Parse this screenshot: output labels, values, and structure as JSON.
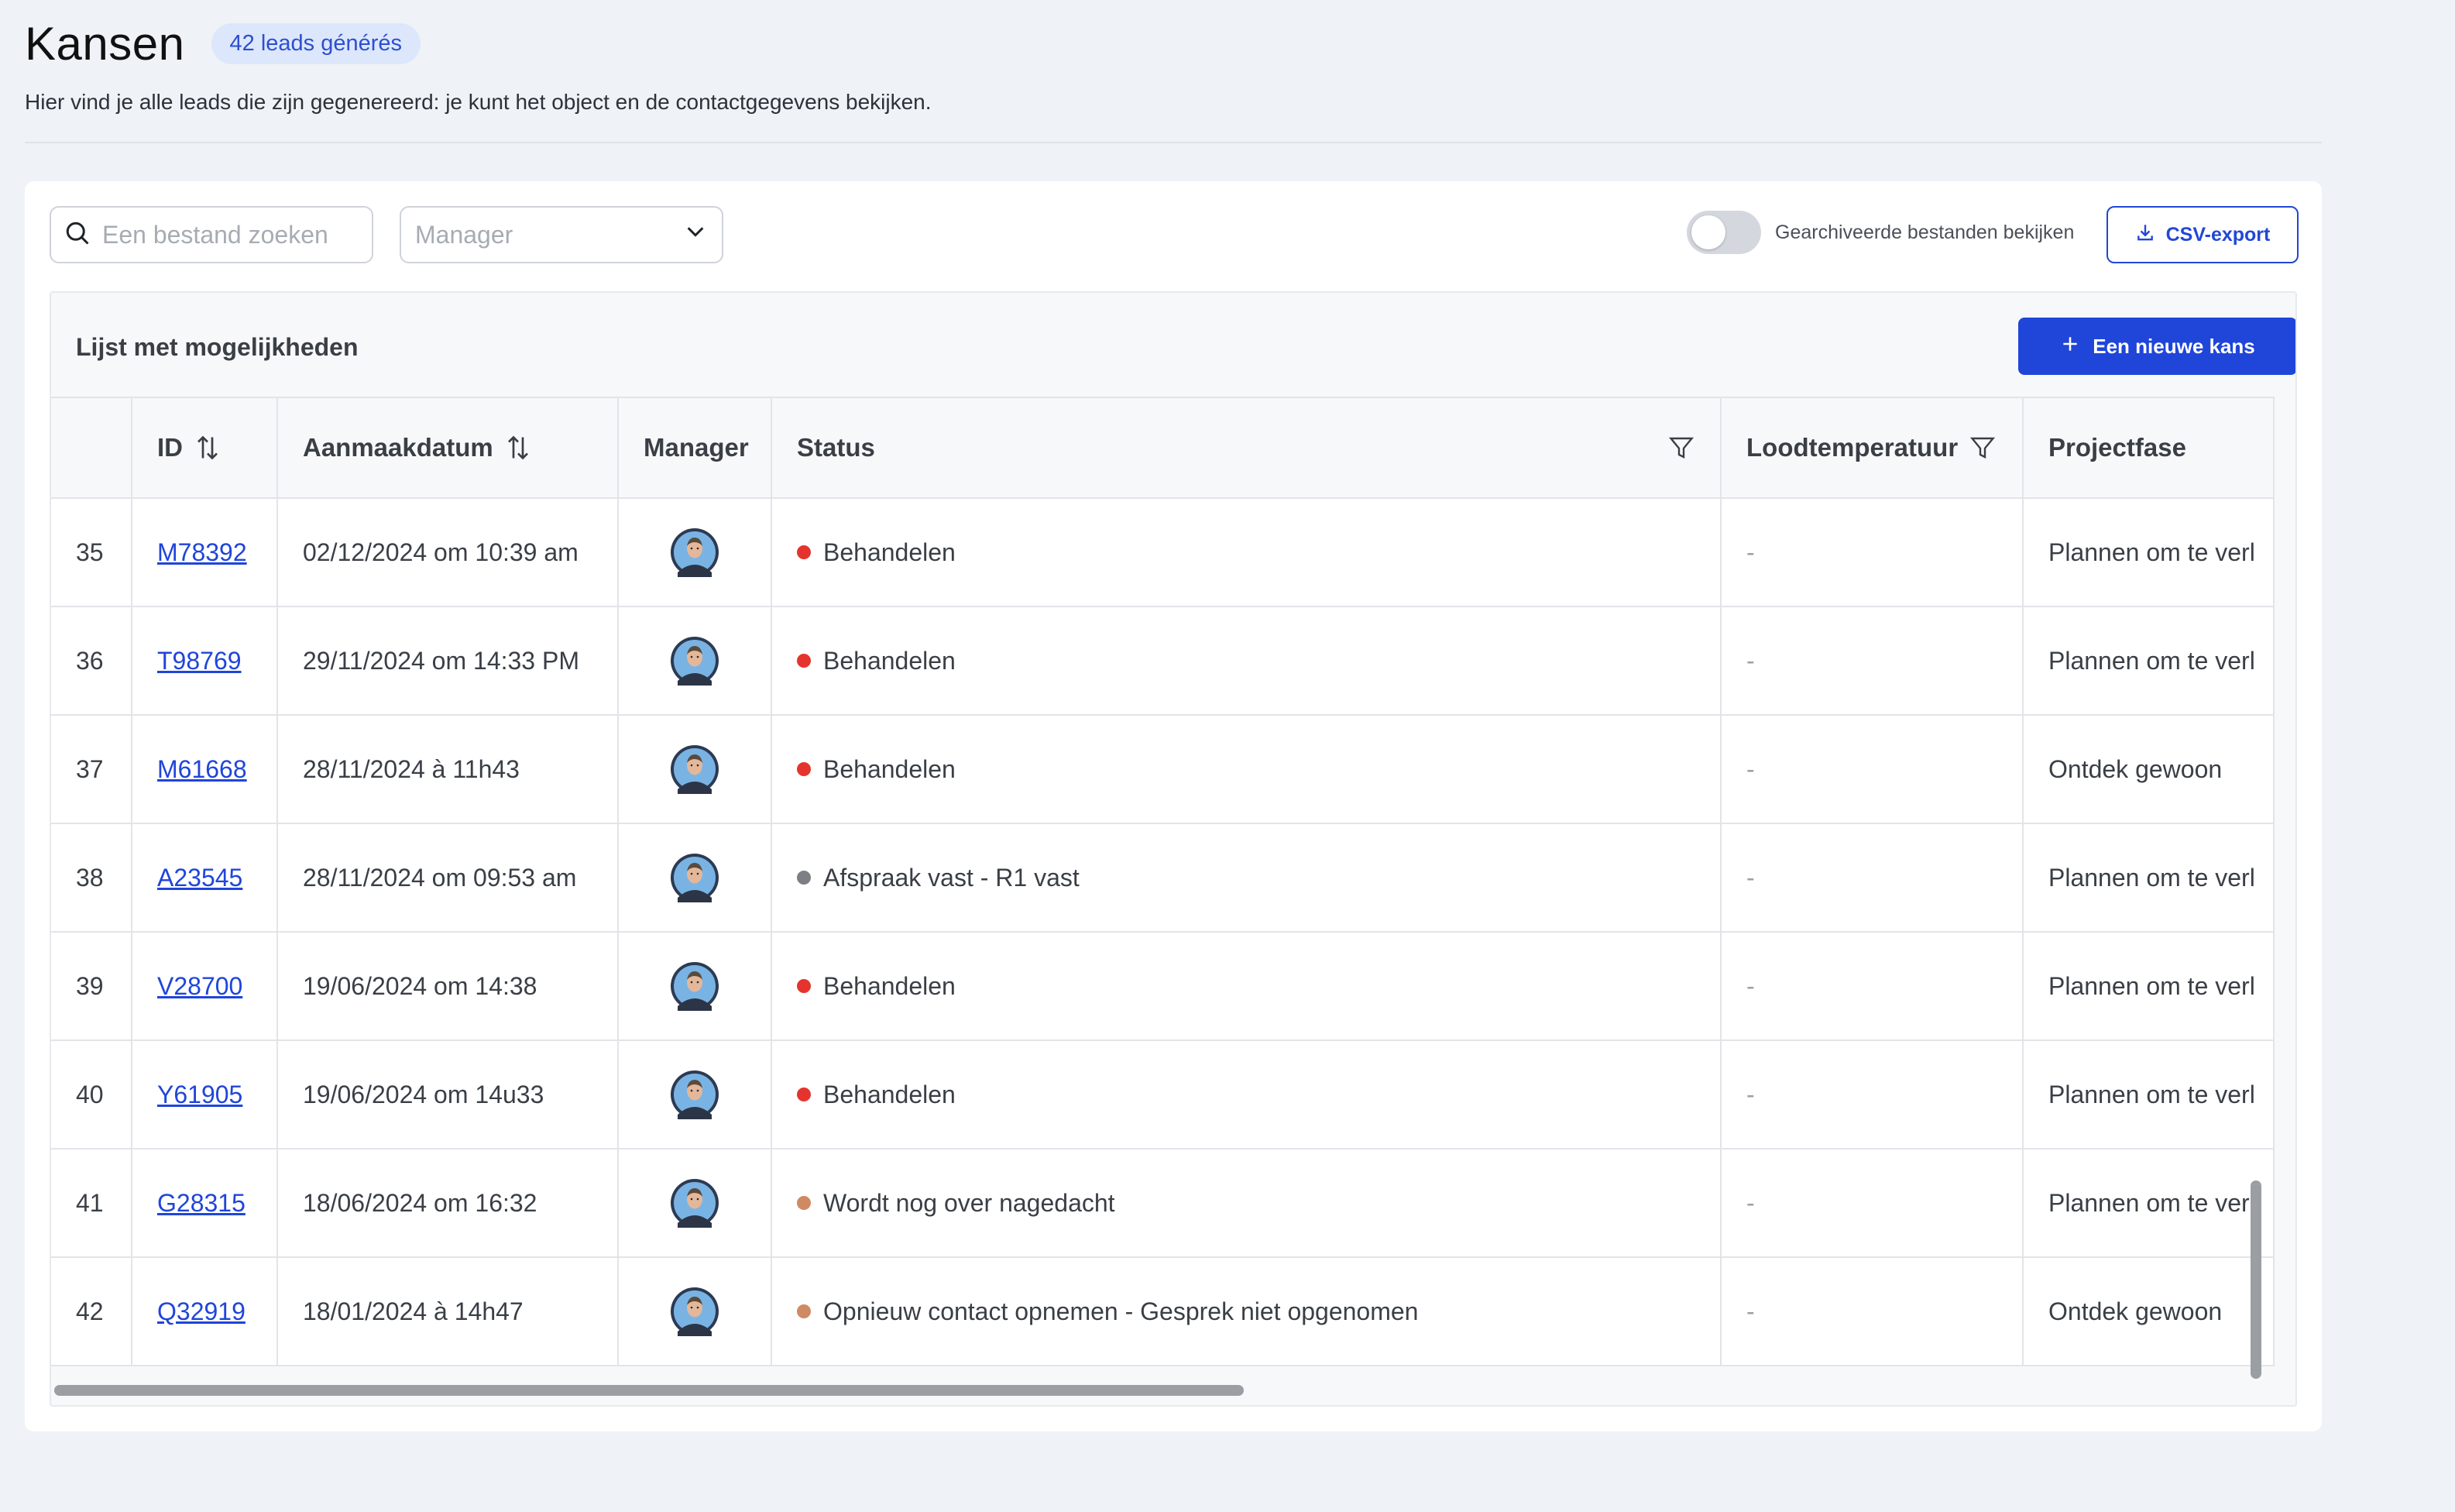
{
  "header": {
    "title": "Kansen",
    "badge": "42 leads générés",
    "subtitle": "Hier vind je alle leads die zijn gegenereerd: je kunt het object en de contactgegevens bekijken."
  },
  "toolbar": {
    "search_placeholder": "Een bestand zoeken",
    "manager_placeholder": "Manager",
    "archived_toggle_label": "Gearchiveerde bestanden bekijken",
    "archived_toggle_on": false,
    "csv_export_label": "CSV-export"
  },
  "panel": {
    "title": "Lijst met mogelijkheden",
    "new_button_label": "Een nieuwe kans"
  },
  "table": {
    "columns": {
      "index": "",
      "id": "ID",
      "created": "Aanmaakdatum",
      "manager": "Manager",
      "status": "Status",
      "temperature": "Loodtemperatuur",
      "phase": "Projectfase"
    },
    "rows": [
      {
        "num": "35",
        "id": "M78392",
        "date": "02/12/2024 om 10:39 am",
        "status": "Behandelen",
        "status_color": "#e5342d",
        "temperature": "-",
        "phase": "Plannen om te verl"
      },
      {
        "num": "36",
        "id": "T98769",
        "date": "29/11/2024 om 14:33 PM",
        "status": "Behandelen",
        "status_color": "#e5342d",
        "temperature": "-",
        "phase": "Plannen om te verl"
      },
      {
        "num": "37",
        "id": "M61668",
        "date": "28/11/2024 à 11h43",
        "status": "Behandelen",
        "status_color": "#e5342d",
        "temperature": "-",
        "phase": "Ontdek gewoon"
      },
      {
        "num": "38",
        "id": "A23545",
        "date": "28/11/2024 om 09:53 am",
        "status": "Afspraak vast - R1 vast",
        "status_color": "#7d7f84",
        "temperature": "-",
        "phase": "Plannen om te verl"
      },
      {
        "num": "39",
        "id": "V28700",
        "date": "19/06/2024 om 14:38",
        "status": "Behandelen",
        "status_color": "#e5342d",
        "temperature": "-",
        "phase": "Plannen om te verl"
      },
      {
        "num": "40",
        "id": "Y61905",
        "date": "19/06/2024 om 14u33",
        "status": "Behandelen",
        "status_color": "#e5342d",
        "temperature": "-",
        "phase": "Plannen om te verl"
      },
      {
        "num": "41",
        "id": "G28315",
        "date": "18/06/2024 om 16:32",
        "status": "Wordt nog over nagedacht",
        "status_color": "#cf8a63",
        "temperature": "-",
        "phase": "Plannen om te verl"
      },
      {
        "num": "42",
        "id": "Q32919",
        "date": "18/01/2024 à 14h47",
        "status": "Opnieuw contact opnemen - Gesprek niet opgenomen",
        "status_color": "#cf8a63",
        "temperature": "-",
        "phase": "Ontdek gewoon"
      }
    ]
  },
  "icons": {
    "search": "search-icon",
    "dropdown": "chevron-down-icon",
    "download": "download-icon",
    "plus": "plus-icon",
    "sort": "sort-icon",
    "filter": "filter-icon",
    "avatar": "avatar"
  },
  "colors": {
    "accent": "#1f45d9",
    "badge_bg": "#dde7fb",
    "page_bg": "#eff2f7"
  }
}
